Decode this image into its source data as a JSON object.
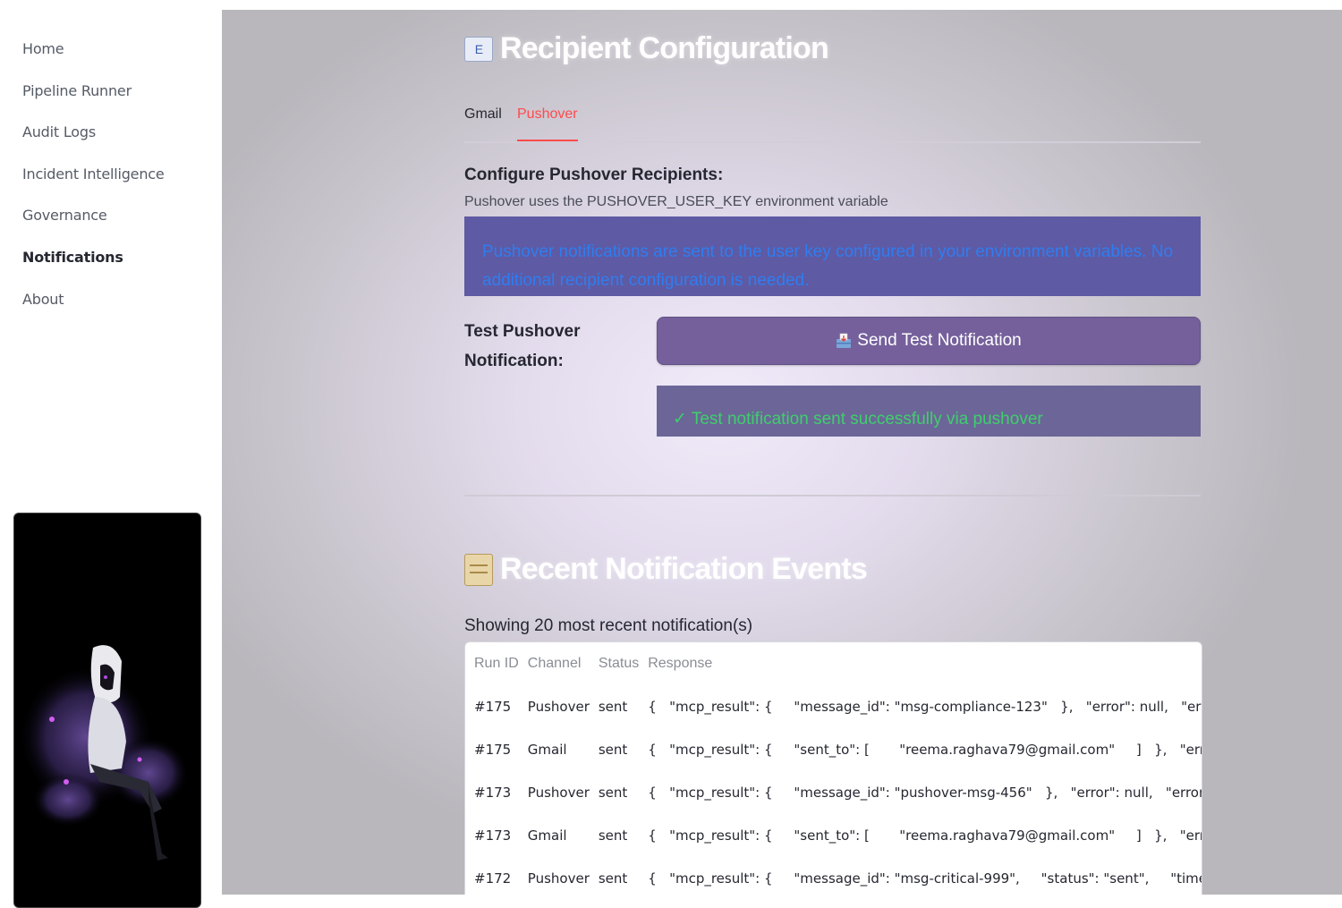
{
  "sidebar": {
    "items": [
      {
        "label": "Home"
      },
      {
        "label": "Pipeline Runner"
      },
      {
        "label": "Audit Logs"
      },
      {
        "label": "Incident Intelligence"
      },
      {
        "label": "Governance"
      },
      {
        "label": "Notifications",
        "active": true
      },
      {
        "label": "About"
      }
    ]
  },
  "recipient": {
    "title_icon": "e-mail-icon",
    "title_icon_glyph": "E",
    "title": "Recipient Configuration",
    "tabs": [
      {
        "label": "Gmail"
      },
      {
        "label": "Pushover",
        "active": true
      }
    ],
    "subhead": "Configure Pushover Recipients:",
    "caption": "Pushover uses the PUSHOVER_USER_KEY environment variable",
    "info_line1": "Pushover notifications are sent to the user key configured in your environment variables. No",
    "info_line2": "additional recipient configuration is needed.",
    "test_label_line1": "Test Pushover",
    "test_label_line2": "Notification:",
    "send_button": "Send Test Notification",
    "success": "✓ Test notification sent successfully via pushover"
  },
  "events": {
    "title_icon": "scroll-icon",
    "title": "Recent Notification Events",
    "showing": "Showing 20 most recent notification(s)",
    "columns": [
      "Run ID",
      "Channel",
      "Status",
      "Response"
    ],
    "rows": [
      {
        "run": "#175",
        "channel": "Pushover",
        "status": "sent",
        "response": "{   \"mcp_result\": {     \"message_id\": \"msg-compliance-123\"   },   \"error\": null,   \"error_type\": null"
      },
      {
        "run": "#175",
        "channel": "Gmail",
        "status": "sent",
        "response": "{   \"mcp_result\": {     \"sent_to\": [       \"reema.raghava79@gmail.com\"     ]   },   \"error\": null"
      },
      {
        "run": "#173",
        "channel": "Pushover",
        "status": "sent",
        "response": "{   \"mcp_result\": {     \"message_id\": \"pushover-msg-456\"   },   \"error\": null,   \"error_type\": null"
      },
      {
        "run": "#173",
        "channel": "Gmail",
        "status": "sent",
        "response": "{   \"mcp_result\": {     \"sent_to\": [       \"reema.raghava79@gmail.com\"     ]   },   \"error\": null"
      },
      {
        "run": "#172",
        "channel": "Pushover",
        "status": "sent",
        "response": "{   \"mcp_result\": {     \"message_id\": \"msg-critical-999\",     \"status\": \"sent\",     \"timestamp\""
      }
    ]
  },
  "colors": {
    "accent": "#ff4b4b",
    "info_bg": "#5e5aa3",
    "info_text": "#2f7df0",
    "button_bg": "#75609c",
    "success_text": "#3ecf6c"
  }
}
